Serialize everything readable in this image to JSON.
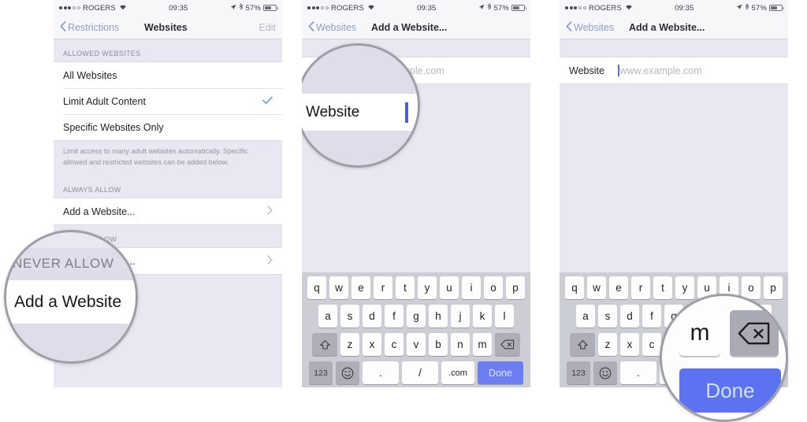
{
  "status_bar": {
    "carrier": "ROGERS",
    "time": "09:35",
    "battery_percent": "57%",
    "signal_dots_filled": 3,
    "signal_dots_hollow": 2,
    "wifi_icon": "wifi-icon",
    "location_icon": "location-arrow-icon",
    "bluetooth_icon": "bluetooth-icon",
    "battery_icon": "battery-icon"
  },
  "panel1": {
    "nav": {
      "back_label": "Restrictions",
      "title": "Websites",
      "edit_label": "Edit"
    },
    "section1_header": "ALLOWED WEBSITES",
    "rows": [
      {
        "label": "All Websites",
        "accessory": "none"
      },
      {
        "label": "Limit Adult Content",
        "accessory": "check"
      },
      {
        "label": "Specific Websites Only",
        "accessory": "none"
      }
    ],
    "footnote": "Limit access to many adult websites automatically. Specific allowed and restricted websites can be added below.",
    "section2_header": "ALWAYS ALLOW",
    "always_allow_row": {
      "label": "Add a Website...",
      "accessory": "chevron"
    },
    "section3_header": "NEVER ALLOW",
    "never_allow_row": {
      "label": "Add a Website...",
      "accessory": "chevron"
    },
    "magnifier": {
      "section_header": "NEVER ALLOW",
      "row_label": "Add a Website"
    }
  },
  "panel2": {
    "nav": {
      "back_label": "Websites",
      "title": "Add a Website..."
    },
    "field": {
      "label": "Website",
      "placeholder": "www.example.com"
    },
    "magnifier": {
      "label": "Website",
      "cursor": "text-cursor"
    }
  },
  "panel3": {
    "nav": {
      "back_label": "Websites",
      "title": "Add a Website..."
    },
    "field": {
      "label": "Website",
      "placeholder": "www.example.com"
    },
    "magnifier": {
      "key_m": "m",
      "delete_key": "delete-key",
      "done_label": "Done"
    }
  },
  "keyboard": {
    "row1": [
      "q",
      "w",
      "e",
      "r",
      "t",
      "y",
      "u",
      "i",
      "o",
      "p"
    ],
    "row2": [
      "a",
      "s",
      "d",
      "f",
      "g",
      "h",
      "j",
      "k",
      "l"
    ],
    "row3": [
      "z",
      "x",
      "c",
      "v",
      "b",
      "n",
      "m"
    ],
    "shift_key": "shift-key",
    "delete_key": "delete-key",
    "numbers_key": "123",
    "emoji_key": "emoji-key",
    "period_key": ".",
    "slash_key": "/",
    "com_key": ".com",
    "done_key": "Done"
  },
  "colors": {
    "accent_blue": "#6c7ef2",
    "link_blue": "#8c9fc6",
    "check_blue": "#5fa8d8",
    "panel_bg": "#e8e7f2",
    "keyboard_bg": "#cdced5"
  }
}
